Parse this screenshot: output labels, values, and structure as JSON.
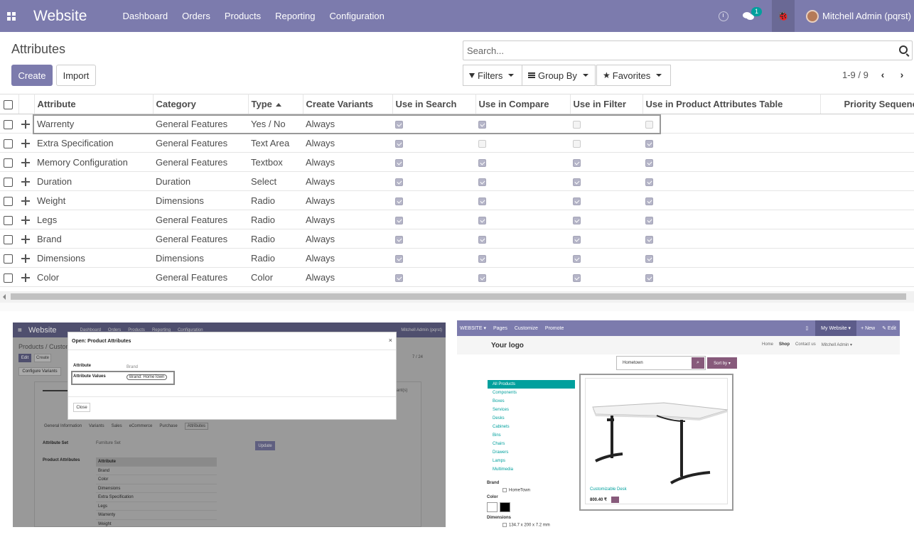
{
  "navbar": {
    "app_name": "Website",
    "menu": [
      "Dashboard",
      "Orders",
      "Products",
      "Reporting",
      "Configuration"
    ],
    "chat_badge": "1",
    "user": "Mitchell Admin (pqrst)",
    "icons": [
      "apps-icon",
      "clock-icon",
      "chat-icon",
      "bug-icon",
      "avatar"
    ],
    "accent_color": "#7c7bad"
  },
  "control_panel": {
    "title": "Attributes",
    "create_label": "Create",
    "import_label": "Import",
    "search_placeholder": "Search...",
    "filters_label": "Filters",
    "group_by_label": "Group By",
    "favorites_label": "Favorites",
    "pager": "1-9 / 9",
    "pager_prev": "‹",
    "pager_next": "›"
  },
  "table": {
    "columns": [
      "Attribute",
      "Category",
      "Type",
      "Create Variants",
      "Use in Search",
      "Use in Compare",
      "Use in Filter",
      "Use in Product Attributes Table",
      "Priority Sequence"
    ],
    "sorted_column": "Type",
    "rows": [
      {
        "attribute": "Warrenty",
        "category": "General Features",
        "type": "Yes / No",
        "variants": "Always",
        "search": true,
        "compare": true,
        "filter": false,
        "table": false
      },
      {
        "attribute": "Extra Specification",
        "category": "General Features",
        "type": "Text Area",
        "variants": "Always",
        "search": true,
        "compare": false,
        "filter": false,
        "table": true
      },
      {
        "attribute": "Memory Configuration",
        "category": "General Features",
        "type": "Textbox",
        "variants": "Always",
        "search": true,
        "compare": true,
        "filter": true,
        "table": true
      },
      {
        "attribute": "Duration",
        "category": "Duration",
        "type": "Select",
        "variants": "Always",
        "search": true,
        "compare": true,
        "filter": true,
        "table": true
      },
      {
        "attribute": "Weight",
        "category": "Dimensions",
        "type": "Radio",
        "variants": "Always",
        "search": true,
        "compare": true,
        "filter": true,
        "table": true
      },
      {
        "attribute": "Legs",
        "category": "General Features",
        "type": "Radio",
        "variants": "Always",
        "search": true,
        "compare": true,
        "filter": true,
        "table": true
      },
      {
        "attribute": "Brand",
        "category": "General Features",
        "type": "Radio",
        "variants": "Always",
        "search": true,
        "compare": true,
        "filter": true,
        "table": true
      },
      {
        "attribute": "Dimensions",
        "category": "Dimensions",
        "type": "Radio",
        "variants": "Always",
        "search": true,
        "compare": true,
        "filter": true,
        "table": true
      },
      {
        "attribute": "Color",
        "category": "General Features",
        "type": "Color",
        "variants": "Always",
        "search": true,
        "compare": true,
        "filter": true,
        "table": true
      }
    ]
  },
  "left_screenshot": {
    "nav_brand": "Website",
    "nav_items": [
      "Dashboard",
      "Orders",
      "Products",
      "Reporting",
      "Configuration"
    ],
    "nav_user": "Mitchell Admin (pqrst)",
    "breadcrumb": "Products / Custom",
    "edit_label": "Edit",
    "create_label": "Create",
    "configure_variants": "Configure Variants",
    "pager": "7 / 24",
    "partial_label": "ant(s)",
    "tabs": [
      "General Information",
      "Variants",
      "Sales",
      "eCommerce",
      "Purchase",
      "Attributes"
    ],
    "attribute_set_label": "Attribute Set",
    "attribute_set_value": "Furniture Set",
    "product_attributes_label": "Product Attributes",
    "update_label": "Update",
    "attr_table_header": "Attribute",
    "attr_table_rows": [
      "Brand",
      "Color",
      "Dimensions",
      "Extra Specification",
      "Legs",
      "Warrenty",
      "Weight"
    ],
    "dialog": {
      "title": "Open: Product Attributes",
      "close": "×",
      "attribute_label": "Attribute",
      "attribute_value": "Brand",
      "values_label": "Attribute Values",
      "values_tag": "Brand: HomeTown",
      "close_button": "Close"
    }
  },
  "right_screenshot": {
    "nav_left": [
      "WEBSITE ▾",
      "Pages",
      "Customize",
      "Promote"
    ],
    "nav_right": [
      "My Website ▾",
      "+ New",
      "✎ Edit"
    ],
    "logo": "Your logo",
    "links": [
      "Home",
      "Shop",
      "Contact us",
      "Mitchell Admin ▾"
    ],
    "search_value": "Hometown",
    "sort_label": "Sort by ▾",
    "categories": [
      "All Products",
      "Components",
      "Boxes",
      "Services",
      "Desks",
      "Cabinets",
      "Bins",
      "Chairs",
      "Drawers",
      "Lamps",
      "Multimedia"
    ],
    "brand_title": "Brand",
    "brand_option": "HomeTown",
    "color_title": "Color",
    "color_swatches": [
      "#ffffff",
      "#000000"
    ],
    "dimensions_title": "Dimensions",
    "dimensions_option": "134.7 x 200 x 7.2 mm",
    "product_name": "Customizable Desk",
    "product_price": "800.40 ₹"
  }
}
